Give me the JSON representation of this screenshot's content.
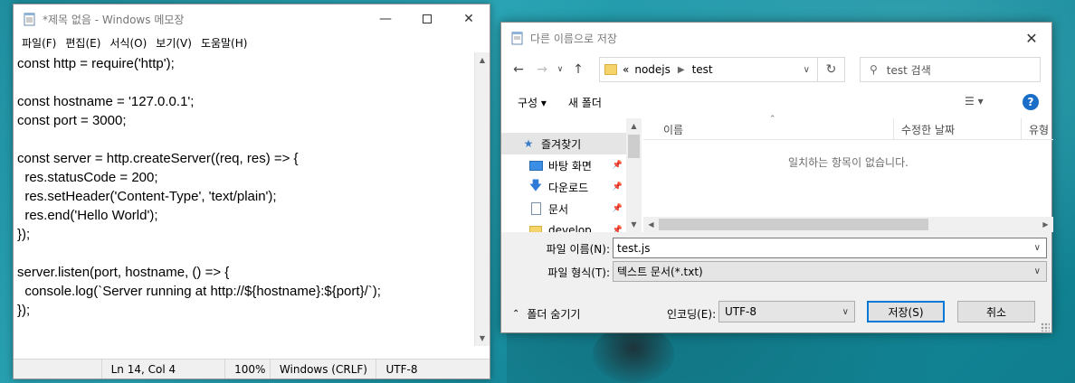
{
  "notepad": {
    "title": "*제목 없음 - Windows 메모장",
    "menu": [
      "파일(F)",
      "편집(E)",
      "서식(O)",
      "보기(V)",
      "도움말(H)"
    ],
    "content": "const http = require('http');\n\nconst hostname = '127.0.0.1';\nconst port = 3000;\n\nconst server = http.createServer((req, res) => {\n  res.statusCode = 200;\n  res.setHeader('Content-Type', 'text/plain');\n  res.end('Hello World');\n});\n\nserver.listen(port, hostname, () => {\n  console.log(`Server running at http://${hostname}:${port}/`);\n});",
    "status": {
      "position": "Ln 14, Col 4",
      "zoom": "100%",
      "line_ending": "Windows (CRLF)",
      "encoding": "UTF-8"
    }
  },
  "dialog": {
    "title": "다른 이름으로 저장",
    "breadcrumb": {
      "overflow": "«",
      "parts": [
        "nodejs",
        "test"
      ]
    },
    "search_placeholder": "test 검색",
    "toolbar": {
      "organize": "구성 ▾",
      "new_folder": "새 폴더"
    },
    "tree": [
      {
        "label": "즐겨찾기",
        "icon": "star-icon",
        "pinned": false
      },
      {
        "label": "바탕 화면",
        "icon": "desktop-icon",
        "pinned": true
      },
      {
        "label": "다운로드",
        "icon": "download-icon",
        "pinned": true
      },
      {
        "label": "문서",
        "icon": "document-icon",
        "pinned": true
      },
      {
        "label": "develop",
        "icon": "folder-icon",
        "pinned": true
      }
    ],
    "columns": [
      "이름",
      "수정한 날짜",
      "유형"
    ],
    "empty_message": "일치하는 항목이 없습니다.",
    "filename_label": "파일 이름(N):",
    "filename_value": "test.js",
    "filetype_label": "파일 형식(T):",
    "filetype_value": "텍스트 문서(*.txt)",
    "hide_folders": "폴더 숨기기",
    "encoding_label": "인코딩(E):",
    "encoding_value": "UTF-8",
    "save_button": "저장(S)",
    "cancel_button": "취소"
  }
}
